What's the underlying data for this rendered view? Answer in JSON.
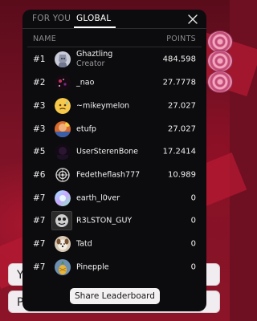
{
  "tabs": [
    {
      "label": "FOR YOU",
      "active": false
    },
    {
      "label": "GLOBAL",
      "active": true
    }
  ],
  "close_icon": "close-icon",
  "columns": {
    "name": "NAME",
    "points": "POINTS"
  },
  "rows": [
    {
      "rank": "#1",
      "name": "Ghaztling",
      "subtitle": "Creator",
      "points": "484.598",
      "avatar": "avatar-lowpoly-portrait"
    },
    {
      "rank": "#2",
      "name": "_nao",
      "points": "27.7778",
      "avatar": "avatar-dark-sparkle"
    },
    {
      "rank": "#3",
      "name": "~mikeymelon",
      "points": "27.027",
      "avatar": "avatar-sweat-emoji"
    },
    {
      "rank": "#3",
      "name": "etufp",
      "points": "27.027",
      "avatar": "avatar-photo-colorful"
    },
    {
      "rank": "#5",
      "name": "UserSterenBone",
      "points": "17.2414",
      "avatar": "avatar-dark-photo"
    },
    {
      "rank": "#6",
      "name": "Fedetheflash777",
      "points": "10.989",
      "avatar": "avatar-bw-pattern"
    },
    {
      "rank": "#7",
      "name": "earth_l0ver",
      "points": "0",
      "avatar": "avatar-holographic"
    },
    {
      "rank": "#7",
      "name": "R3LSTON_GUY",
      "points": "0",
      "avatar": "avatar-square-mask"
    },
    {
      "rank": "#7",
      "name": "Tatd",
      "points": "0",
      "avatar": "avatar-dog-photo"
    },
    {
      "rank": "#7",
      "name": "Pinepple",
      "points": "0",
      "avatar": "avatar-pineapple"
    }
  ],
  "share_button": "Share Leaderboard",
  "background": {
    "button_1_partial": "Y",
    "button_2_partial": "P"
  },
  "colors": {
    "modal_bg": "#0c0c0e",
    "scene_red": "#b51a33",
    "active_tab": "#ffffff",
    "muted_text": "#8a8a90"
  }
}
